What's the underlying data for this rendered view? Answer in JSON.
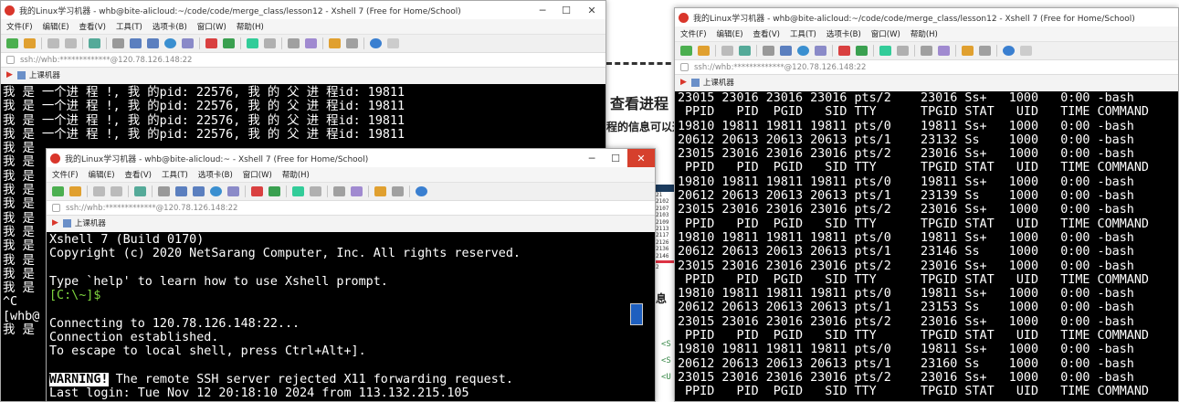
{
  "left_window": {
    "title": "我的Linux学习机器 - whb@bite-alicloud:~/code/code/merge_class/lesson12 - Xshell 7 (Free for Home/School)",
    "menu": [
      "文件(F)",
      "编辑(E)",
      "查看(V)",
      "工具(T)",
      "选项卡(B)",
      "窗口(W)",
      "帮助(H)"
    ],
    "address": "ssh://whb:*************@120.78.126.148:22",
    "tab_label": "上课机器",
    "lines": [
      "我 是 一个进 程 !, 我 的pid: 22576, 我 的 父 进 程id: 19811",
      "我 是 一个进 程 !, 我 的pid: 22576, 我 的 父 进 程id: 19811",
      "我 是 一个进 程 !, 我 的pid: 22576, 我 的 父 进 程id: 19811",
      "我 是 一个进 程 !, 我 的pid: 22576, 我 的 父 进 程id: 19811",
      "我 是",
      "我 是",
      "我 是",
      "我 是",
      "我 是",
      "我 是",
      "我 是",
      "我 是",
      "我 是",
      "我 是",
      "我 是",
      "^C",
      "[whb@",
      "我 是"
    ]
  },
  "middle_window": {
    "title": "我的Linux学习机器 - whb@bite-alicloud:~ - Xshell 7 (Free for Home/School)",
    "menu": [
      "文件(F)",
      "编辑(E)",
      "查看(V)",
      "工具(T)",
      "选项卡(B)",
      "窗口(W)",
      "帮助(H)"
    ],
    "address": "ssh://whb:*************@120.78.126.148:22",
    "tab_label": "上课机器",
    "lines": [
      "Xshell 7 (Build 0170)",
      "Copyright (c) 2020 NetSarang Computer, Inc. All rights reserved.",
      "",
      "Type `help' to learn how to use Xshell prompt.",
      "[C:\\~]$",
      "",
      "Connecting to 120.78.126.148:22...",
      "Connection established.",
      "To escape to local shell, press Ctrl+Alt+].",
      "",
      "The remote SSH server rejected X11 forwarding request.",
      "Last login: Tue Nov 12 20:18:10 2024 from 113.132.215.105"
    ],
    "warning_label": "WARNING!"
  },
  "right_window": {
    "title": "我的Linux学习机器 - whb@bite-alicloud:~/code/code/merge_class/lesson12 - Xshell 7 (Free for Home/School)",
    "menu": [
      "文件(F)",
      "编辑(E)",
      "查看(V)",
      "工具(T)",
      "选项卡(B)",
      "窗口(W)",
      "帮助(H)"
    ],
    "address": "ssh://whb:*************@120.78.126.148:22",
    "tab_label": "上课机器",
    "lines": [
      "23015 23016 23016 23016 pts/2    23016 Ss+   1000   0:00 -bash",
      " PPID   PID  PGID   SID TTY      TPGID STAT   UID   TIME COMMAND",
      "19810 19811 19811 19811 pts/0    19811 Ss+   1000   0:00 -bash",
      "20612 20613 20613 20613 pts/1    23132 Ss    1000   0:00 -bash",
      "23015 23016 23016 23016 pts/2    23016 Ss+   1000   0:00 -bash",
      " PPID   PID  PGID   SID TTY      TPGID STAT   UID   TIME COMMAND",
      "19810 19811 19811 19811 pts/0    19811 Ss+   1000   0:00 -bash",
      "20612 20613 20613 20613 pts/1    23139 Ss    1000   0:00 -bash",
      "23015 23016 23016 23016 pts/2    23016 Ss+   1000   0:00 -bash",
      " PPID   PID  PGID   SID TTY      TPGID STAT   UID   TIME COMMAND",
      "19810 19811 19811 19811 pts/0    19811 Ss+   1000   0:00 -bash",
      "20612 20613 20613 20613 pts/1    23146 Ss    1000   0:00 -bash",
      "23015 23016 23016 23016 pts/2    23016 Ss+   1000   0:00 -bash",
      " PPID   PID  PGID   SID TTY      TPGID STAT   UID   TIME COMMAND",
      "19810 19811 19811 19811 pts/0    19811 Ss+   1000   0:00 -bash",
      "20612 20613 20613 20613 pts/1    23153 Ss    1000   0:00 -bash",
      "23015 23016 23016 23016 pts/2    23016 Ss+   1000   0:00 -bash",
      " PPID   PID  PGID   SID TTY      TPGID STAT   UID   TIME COMMAND",
      "19810 19811 19811 19811 pts/0    19811 Ss+   1000   0:00 -bash",
      "20612 20613 20613 20613 pts/1    23160 Ss    1000   0:00 -bash",
      "23015 23016 23016 23016 pts/2    23016 Ss+   1000   0:00 -bash",
      " PPID   PID  PGID   SID TTY      TPGID STAT   UID   TIME COMMAND"
    ]
  },
  "background_doc": {
    "heading": "查看进程",
    "line1": "程的信息可以通",
    "line2": "息",
    "tags": [
      "<S",
      "<S",
      "<U"
    ]
  },
  "colors": {
    "terminal_bg": "#000000",
    "terminal_fg": "#ffffff",
    "prompt_green": "#7fd63f",
    "close_red": "#d6402d"
  }
}
